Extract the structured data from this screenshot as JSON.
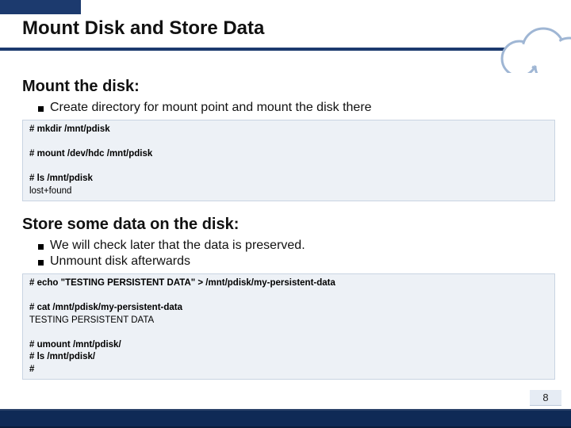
{
  "title": "Mount Disk and Store Data",
  "sections": [
    {
      "heading": "Mount the disk:",
      "bullets": [
        "Create directory for mount point and mount the disk there"
      ],
      "code_groups": [
        [
          {
            "kind": "cmd",
            "text": "# mkdir /mnt/pdisk"
          }
        ],
        [
          {
            "kind": "cmd",
            "text": "# mount /dev/hdc /mnt/pdisk"
          }
        ],
        [
          {
            "kind": "cmd",
            "text": "# ls /mnt/pdisk"
          },
          {
            "kind": "out",
            "text": "lost+found"
          }
        ]
      ]
    },
    {
      "heading": "Store some data on the disk:",
      "bullets": [
        "We will check later that the data is preserved.",
        "Unmount disk afterwards"
      ],
      "code_groups": [
        [
          {
            "kind": "cmd",
            "text": "# echo \"TESTING PERSISTENT DATA\" > /mnt/pdisk/my-persistent-data"
          }
        ],
        [
          {
            "kind": "cmd",
            "text": "# cat /mnt/pdisk/my-persistent-data"
          },
          {
            "kind": "out",
            "text": "TESTING PERSISTENT DATA"
          }
        ],
        [
          {
            "kind": "cmd",
            "text": "# umount /mnt/pdisk/"
          },
          {
            "kind": "cmd",
            "text": "# ls /mnt/pdisk/"
          },
          {
            "kind": "cmd",
            "text": "#"
          }
        ]
      ]
    }
  ],
  "page_number": "8"
}
